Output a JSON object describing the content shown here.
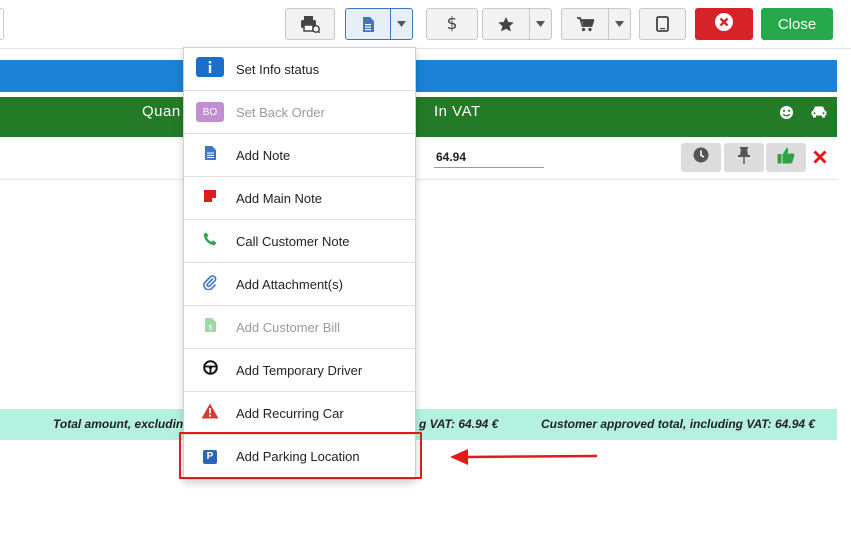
{
  "toolbar": {
    "close_label": "Close"
  },
  "table": {
    "col_quantity": "Quan",
    "col_vat": "In VAT",
    "row_vat_value": "64.94"
  },
  "totals": {
    "left": "Total amount, excludin",
    "mid": "g VAT: 64.94 €",
    "right": "Customer approved total, including VAT: 64.94 €"
  },
  "menu": {
    "items": [
      {
        "label": "Set Info status",
        "icon": "info-icon",
        "badge": "i",
        "disabled": false
      },
      {
        "label": "Set Back Order",
        "icon": "back-order-icon",
        "badge": "BO",
        "disabled": true
      },
      {
        "label": "Add Note",
        "icon": "note-icon",
        "disabled": false
      },
      {
        "label": "Add Main Note",
        "icon": "main-note-icon",
        "disabled": false
      },
      {
        "label": "Call Customer Note",
        "icon": "phone-icon",
        "disabled": false
      },
      {
        "label": "Add Attachment(s)",
        "icon": "paperclip-icon",
        "disabled": false
      },
      {
        "label": "Add Customer Bill",
        "icon": "bill-icon",
        "disabled": true
      },
      {
        "label": "Add Temporary Driver",
        "icon": "steering-wheel-icon",
        "disabled": false
      },
      {
        "label": "Add Recurring Car",
        "icon": "warning-icon",
        "disabled": false
      },
      {
        "label": "Add Parking Location",
        "icon": "parking-icon",
        "badge": "P",
        "disabled": false
      }
    ]
  },
  "colors": {
    "blue_bar": "#1b82d6",
    "green_header": "#237b27",
    "danger": "#d7222a",
    "success": "#27a84a",
    "totals_bg": "#b4f1e0",
    "highlight": "#e11b1b"
  }
}
